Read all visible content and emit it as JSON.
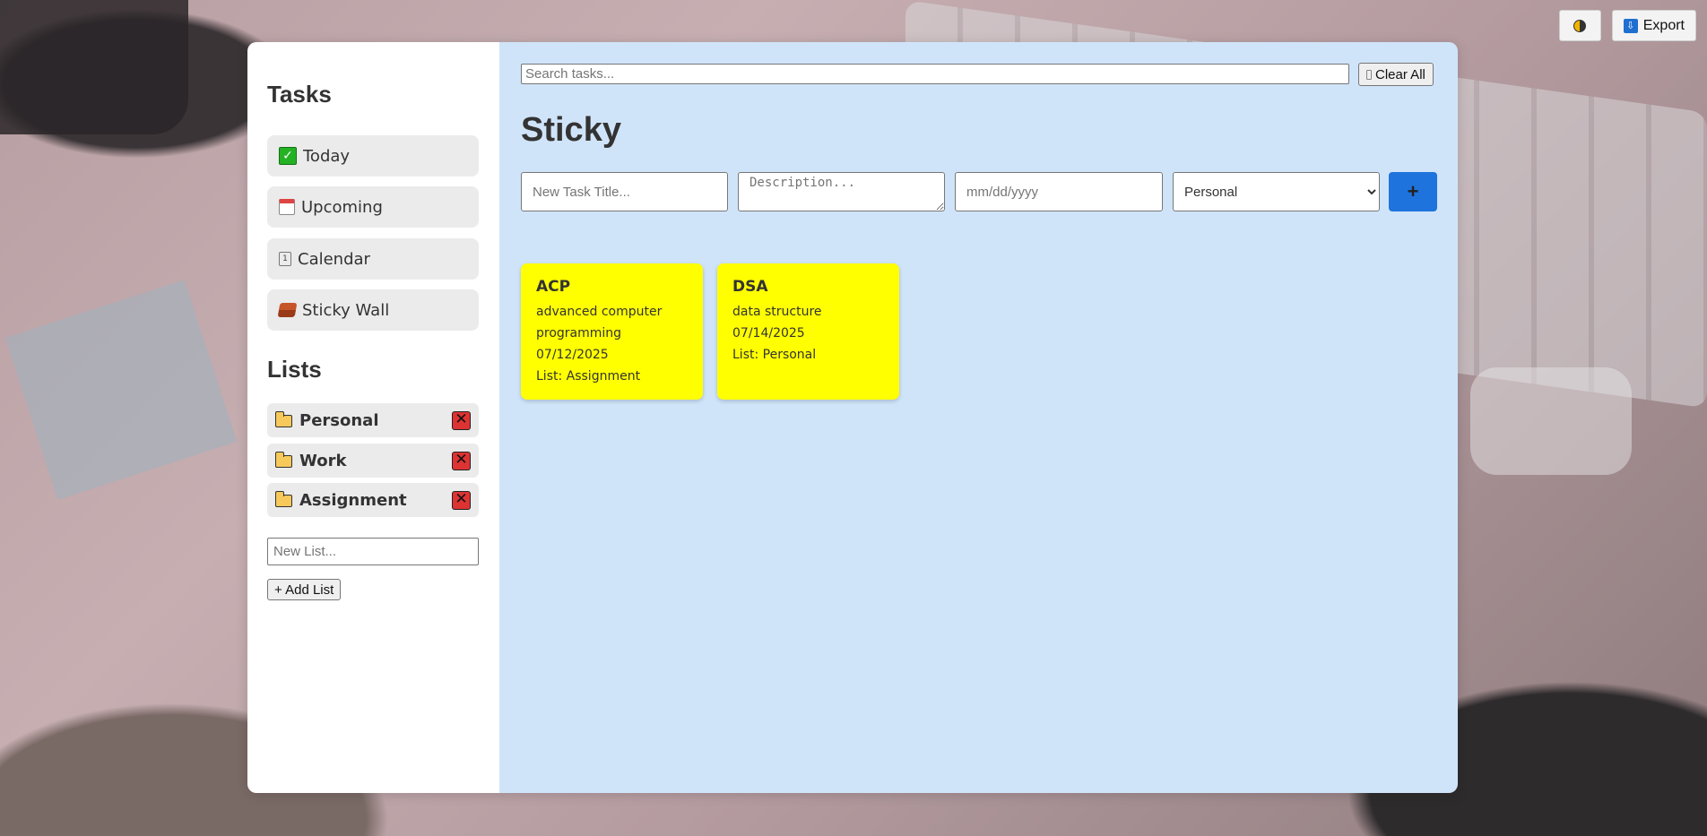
{
  "topbar": {
    "theme_icon": "half-circle-icon",
    "export_label": "Export",
    "export_icon": "download-icon"
  },
  "sidebar": {
    "tasks_heading": "Tasks",
    "nav": [
      {
        "label": "Today",
        "icon": "check-icon"
      },
      {
        "label": "Upcoming",
        "icon": "calendar-icon"
      },
      {
        "label": "Calendar",
        "icon": "date-icon"
      },
      {
        "label": "Sticky Wall",
        "icon": "brick-icon"
      }
    ],
    "lists_heading": "Lists",
    "lists": [
      {
        "label": "Personal"
      },
      {
        "label": "Work"
      },
      {
        "label": "Assignment"
      }
    ],
    "new_list_placeholder": "New List...",
    "add_list_label": "+ Add List"
  },
  "main": {
    "search_placeholder": "Search tasks...",
    "clear_all_label": "Clear All",
    "title": "Sticky",
    "form": {
      "title_placeholder": "New Task Title...",
      "description_placeholder": "Description...",
      "date_placeholder": "mm/dd/yyyy",
      "list_selected": "Personal",
      "add_button_icon": "plus-icon"
    },
    "notes": [
      {
        "title": "ACP",
        "description": "advanced computer programming",
        "date": "07/12/2025",
        "list": "List: Assignment"
      },
      {
        "title": "DSA",
        "description": "data structure",
        "date": "07/14/2025",
        "list": "List: Personal"
      }
    ]
  },
  "colors": {
    "main_bg": "#d0e4f9",
    "sticky_bg": "#ffff00",
    "accent": "#1e73dc",
    "delete": "#dd3333"
  }
}
